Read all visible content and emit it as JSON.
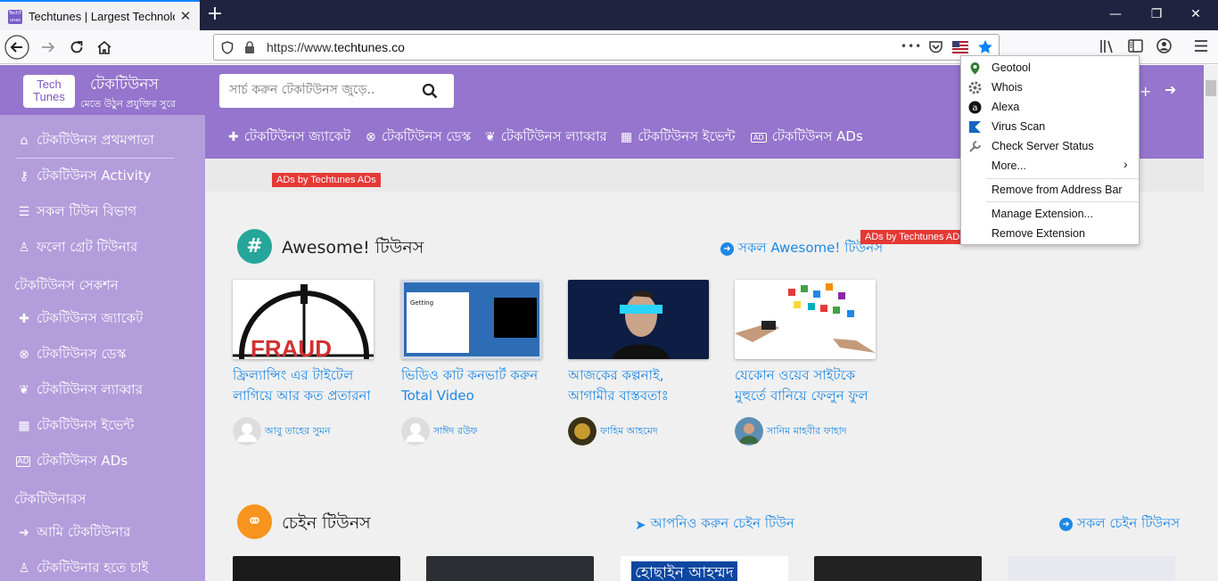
{
  "browser": {
    "tab_title": "Techtunes | Largest Technology",
    "tab_favicon_text": "TechTunes",
    "tab_close": "✕",
    "new_tab": "+",
    "url_scheme": "https://www.",
    "url_domain": "techtunes.co",
    "page_actions": "•••",
    "window_buttons": {
      "minimize": "—",
      "restore": "❐",
      "close": "✕"
    }
  },
  "header": {
    "logo_line1": "Tech",
    "logo_line2": "Tunes",
    "site_name": "টেকটিউনস",
    "tagline": "মেতে উঠুন প্রযুক্তির সুরে",
    "search_placeholder": "সার্চ করুন টেকটিউনস জুড়ে.."
  },
  "sidebar": {
    "items": [
      {
        "label": "টেকটিউনস প্রথমপাতা",
        "icon": "home-icon"
      },
      {
        "label": "টেকটিউনস Activity",
        "icon": "key-icon"
      },
      {
        "label": "সকল টিউন বিভাগ",
        "icon": "list-icon"
      },
      {
        "label": "ফলো গ্রেট টিউনার",
        "icon": "user-icon"
      }
    ],
    "section1": "টেকটিউনস সেকশন",
    "section_items": [
      {
        "label": "টেকটিউনস জ্যাকেট",
        "icon": "medkit-icon"
      },
      {
        "label": "টেকটিউনস ডেস্ক",
        "icon": "lifebuoy-icon"
      },
      {
        "label": "টেকটিউনস ল্যাব্বার",
        "icon": "leaf-icon"
      },
      {
        "label": "টেকটিউনস ইভেন্ট",
        "icon": "calendar-icon"
      },
      {
        "label": "টেকটিউনস ADs",
        "icon": "ad-icon"
      }
    ],
    "section2": "টেকটিউনারস",
    "tuner_items": [
      {
        "label": "আমি টেকটিউনার",
        "icon": "sign-in-icon"
      },
      {
        "label": "টেকটিউনার হতে চাই",
        "icon": "user-plus-icon"
      }
    ]
  },
  "topnav": [
    {
      "label": "টেকটিউনস জ্যাকেট"
    },
    {
      "label": "টেকটিউনস ডেস্ক"
    },
    {
      "label": "টেকটিউনস ল্যাব্বার"
    },
    {
      "label": "টেকটিউনস ইভেন্ট"
    },
    {
      "label": "টেকটিউনস ADs"
    }
  ],
  "ads_label": "ADs by Techtunes ADs",
  "awesome": {
    "title": "Awesome! টিউনস",
    "link": "সকল Awesome! টিউনস",
    "cards": [
      {
        "title": "ফ্রিল্যান্সিং এর টাইটেল লাগিয়ে আর কত প্রতারনা",
        "author": "আবু তাহের সুমন",
        "thumb_text": "FRAUD"
      },
      {
        "title": "ভিডিও কাট কনভার্ট করুন Total Video Converter",
        "author": "সাঈদ রউফ",
        "thumb_text": "Getting"
      },
      {
        "title": "আজকের কল্পনাই, আগামীর বাস্তবতাঃ ভবিষ্যত",
        "author": "ফাহিম আহমেদ",
        "thumb_text": ""
      },
      {
        "title": "যেকোন ওয়েব সাইটকে মুহুর্তে বানিয়ে ফেলুন ফুল",
        "author": "সানিম মাহবীর ফাহাদ",
        "thumb_text": ""
      }
    ]
  },
  "chain": {
    "title": "চেইন টিউনস",
    "link_mid": "আপনিও করুন চেইন টিউন",
    "link": "সকল চেইন টিউনস",
    "thumb3_text": "হোছাইন আহম্মদ"
  },
  "popup": {
    "items": [
      {
        "label": "Geotool"
      },
      {
        "label": "Whois"
      },
      {
        "label": "Alexa"
      },
      {
        "label": "Virus Scan"
      },
      {
        "label": "Check Server Status"
      },
      {
        "label": "More..."
      }
    ],
    "more_arrow": "›",
    "remove_address": "Remove from Address Bar",
    "manage": "Manage Extension...",
    "remove_ext": "Remove Extension"
  }
}
